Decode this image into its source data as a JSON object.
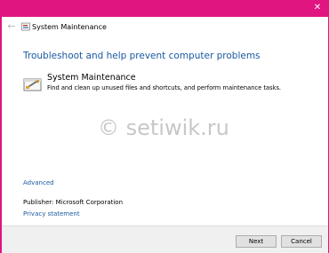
{
  "window": {
    "title": "System Maintenance",
    "accent_color": "#e0157f",
    "close_icon": "close-icon",
    "back_icon": "back-arrow-icon",
    "app_icon": "system-maintenance-icon"
  },
  "content": {
    "heading": "Troubleshoot and help prevent computer problems",
    "task": {
      "title": "System Maintenance",
      "description": "Find and clean up unused files and shortcuts, and perform maintenance tasks.",
      "icon": "maintenance-tool-icon"
    },
    "watermark": "© setiwik.ru",
    "advanced_link": "Advanced",
    "publisher": "Publisher:  Microsoft Corporation",
    "privacy_link": "Privacy statement"
  },
  "footer": {
    "next_label": "Next",
    "cancel_label": "Cancel"
  }
}
